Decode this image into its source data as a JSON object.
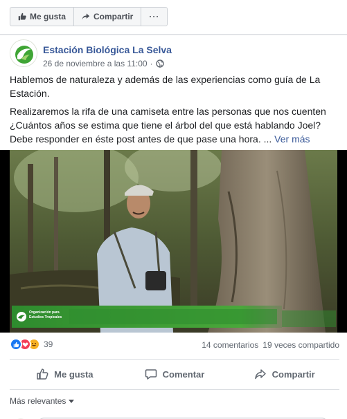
{
  "page_actions": {
    "like_label": "Me gusta",
    "share_label": "Compartir",
    "more_label": "···"
  },
  "post": {
    "page_name": "Estación Biológica La Selva",
    "timestamp": "26 de noviembre a las 11:00",
    "paragraph_1": "Hablemos de naturaleza y además de las experiencias como guía de La Estación.",
    "paragraph_2": "Realizaremos la rifa de una camiseta entre las personas que nos cuenten ¿Cuántos años se estima que tiene el árbol del que está hablando Joel? Debe responder en éste post antes de que pase una hora.",
    "ellipsis": "...",
    "see_more": "Ver más"
  },
  "video": {
    "org_line_1": "Organización para",
    "org_line_2": "Estudios Tropicales"
  },
  "counts": {
    "reactions_total": "39",
    "comments": "14 comentarios",
    "shares": "19 veces compartido"
  },
  "actions": {
    "like": "Me gusta",
    "comment": "Comentar",
    "share": "Compartir"
  },
  "sort": {
    "label": "Más relevantes"
  },
  "colors": {
    "link": "#385898",
    "brand_green": "#3fa535",
    "like_blue": "#1877f2",
    "love_red": "#f33e58",
    "haha_yellow": "#f7b125"
  }
}
